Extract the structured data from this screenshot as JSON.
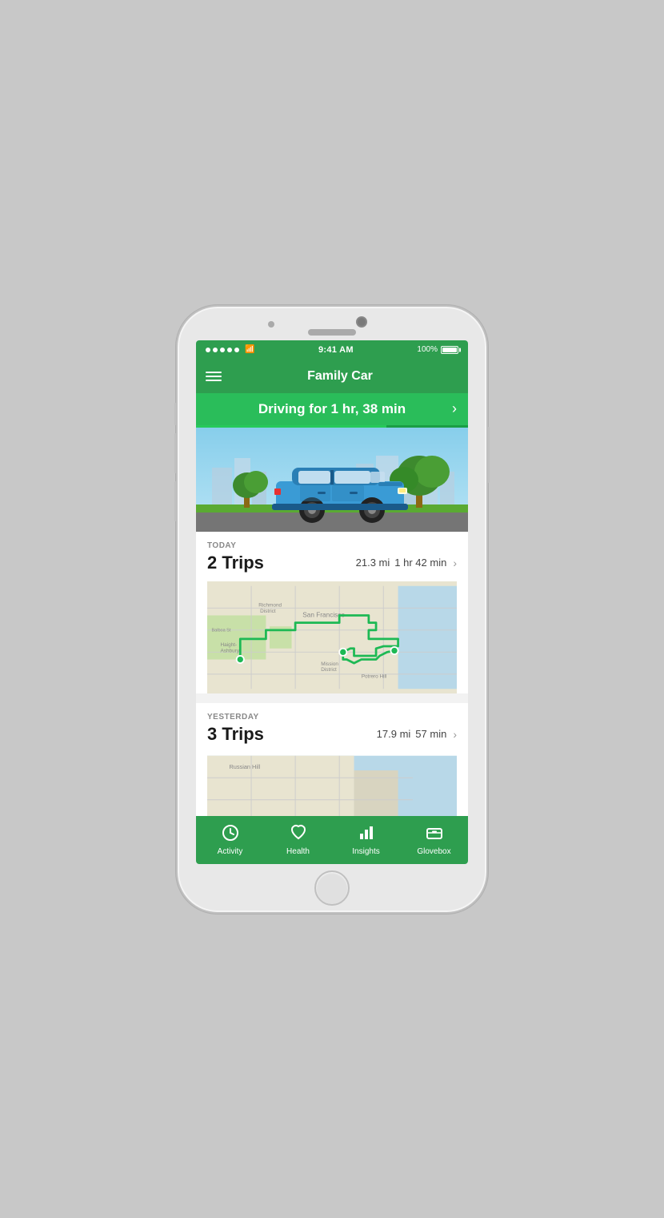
{
  "phone": {
    "status_bar": {
      "signal_label": "signal",
      "wifi_label": "wifi",
      "time": "9:41 AM",
      "battery_percent": "100%"
    },
    "nav_header": {
      "menu_label": "Menu",
      "title": "Family Car"
    },
    "driving_banner": {
      "text": "Driving for 1 hr, 38 min",
      "chevron": "›"
    },
    "today_section": {
      "label": "TODAY",
      "trips_count": "2 Trips",
      "distance": "21.3 mi",
      "duration": "1 hr 42 min",
      "chevron": "›"
    },
    "yesterday_section": {
      "label": "YESTERDAY",
      "trips_count": "3 Trips",
      "distance": "17.9 mi",
      "duration": "57 min",
      "chevron": "›"
    },
    "tab_bar": {
      "tabs": [
        {
          "id": "activity",
          "label": "Activity",
          "icon": "⏱"
        },
        {
          "id": "health",
          "label": "Health",
          "icon": "♡"
        },
        {
          "id": "insights",
          "label": "Insights",
          "icon": "📊"
        },
        {
          "id": "glovebox",
          "label": "Glovebox",
          "icon": "🗂"
        }
      ]
    }
  }
}
